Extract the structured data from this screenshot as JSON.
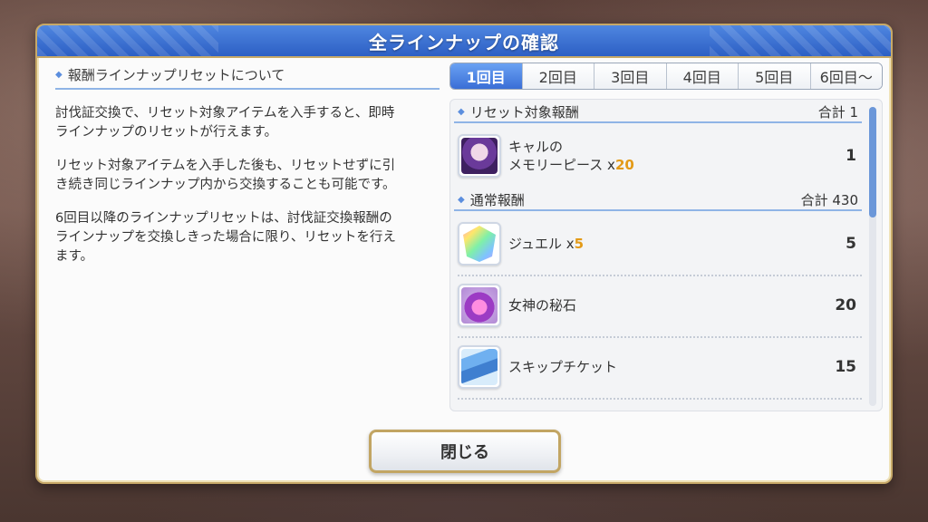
{
  "modal": {
    "title": "全ラインナップの確認"
  },
  "left": {
    "heading": "報酬ラインナップリセットについて",
    "paragraphs": [
      "討伐証交換で、リセット対象アイテムを入手すると、即時ラインナップのリセットが行えます。",
      "リセット対象アイテムを入手した後も、リセットせずに引き続き同じラインナップ内から交換することも可能です。",
      "6回目以降のラインナップリセットは、討伐証交換報酬のラインナップを交換しきった場合に限り、リセットを行えます。"
    ]
  },
  "tabs": [
    {
      "label": "1回目",
      "active": true
    },
    {
      "label": "2回目",
      "active": false
    },
    {
      "label": "3回目",
      "active": false
    },
    {
      "label": "4回目",
      "active": false
    },
    {
      "label": "5回目",
      "active": false
    },
    {
      "label": "6回目〜",
      "active": false
    }
  ],
  "rewards": {
    "reset_category": {
      "name": "リセット対象報酬",
      "total": "合計 1"
    },
    "normal_category": {
      "name": "通常報酬",
      "total": "合計 430"
    },
    "items": [
      {
        "name_line1": "キャルの",
        "name_line2": "メモリーピース",
        "mult": "x",
        "mult_num": "20",
        "count": "1",
        "icon": "kyaru-memory-piece-icon",
        "color": "#8a5ab8"
      },
      {
        "name_line1": "ジュエル",
        "name_line2": "",
        "mult": "x",
        "mult_num": "5",
        "count": "5",
        "icon": "jewel-icon",
        "color": "#7fd6a8"
      },
      {
        "name_line1": "女神の秘石",
        "name_line2": "",
        "mult": "",
        "mult_num": "",
        "count": "20",
        "icon": "goddess-stone-icon",
        "color": "#c25ad8"
      },
      {
        "name_line1": "スキップチケット",
        "name_line2": "",
        "mult": "",
        "mult_num": "",
        "count": "15",
        "icon": "skip-ticket-icon",
        "color": "#4f8fd6"
      }
    ]
  },
  "buttons": {
    "close": "閉じる"
  },
  "colors": {
    "header_blue": "#2d5fc4",
    "accent_gold": "#c7a968",
    "multiplier_orange": "#e39a17"
  }
}
